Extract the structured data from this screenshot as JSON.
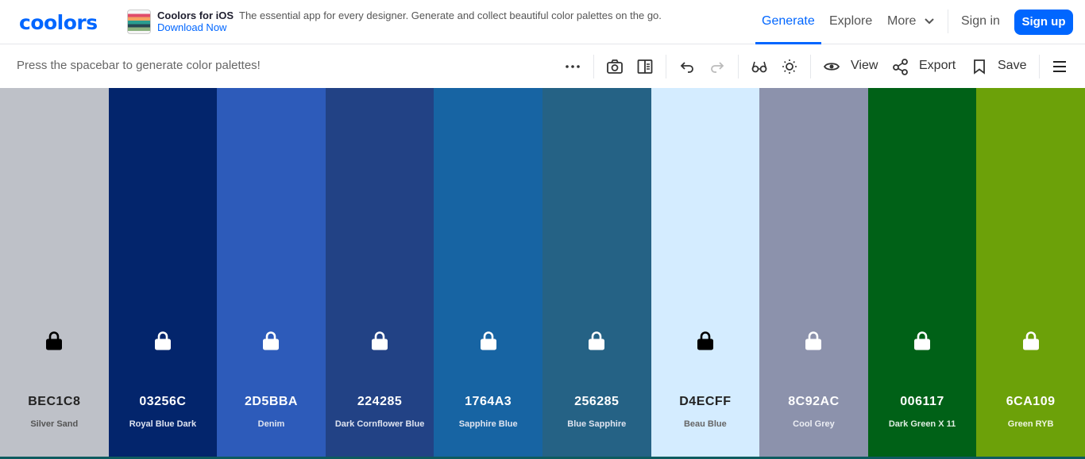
{
  "logo": "coolors",
  "promo": {
    "title": "Coolors for iOS",
    "description": "The essential app for every designer. Generate and collect beautiful color palettes on the go.",
    "link": "Download Now"
  },
  "nav": {
    "generate": "Generate",
    "explore": "Explore",
    "more": "More",
    "signin": "Sign in",
    "signup": "Sign up"
  },
  "toolbar": {
    "hint": "Press the spacebar to generate color palettes!",
    "view": "View",
    "export": "Export",
    "save": "Save"
  },
  "accent_color": "#0066ff",
  "swatches": [
    {
      "hex": "BEC1C8",
      "name": "Silver Sand",
      "color": "#BEC1C8",
      "text_color": "#222222",
      "name_color": "#555555",
      "lock_color": "#000000"
    },
    {
      "hex": "03256C",
      "name": "Royal Blue Dark",
      "color": "#03256C",
      "text_color": "#ffffff",
      "name_color": "#dfe4f0",
      "lock_color": "#ffffff"
    },
    {
      "hex": "2D5BBA",
      "name": "Denim",
      "color": "#2D5BBA",
      "text_color": "#ffffff",
      "name_color": "#dfe4f0",
      "lock_color": "#ffffff"
    },
    {
      "hex": "224285",
      "name": "Dark Cornflower Blue",
      "color": "#224285",
      "text_color": "#ffffff",
      "name_color": "#dfe4f0",
      "lock_color": "#ffffff"
    },
    {
      "hex": "1764A3",
      "name": "Sapphire Blue",
      "color": "#1764A3",
      "text_color": "#ffffff",
      "name_color": "#dfe4f0",
      "lock_color": "#ffffff"
    },
    {
      "hex": "256285",
      "name": "Blue Sapphire",
      "color": "#256285",
      "text_color": "#ffffff",
      "name_color": "#dfe4f0",
      "lock_color": "#ffffff"
    },
    {
      "hex": "D4ECFF",
      "name": "Beau Blue",
      "color": "#D4ECFF",
      "text_color": "#222222",
      "name_color": "#666666",
      "lock_color": "#000000"
    },
    {
      "hex": "8C92AC",
      "name": "Cool Grey",
      "color": "#8C92AC",
      "text_color": "#ffffff",
      "name_color": "#eceef4",
      "lock_color": "#ffffff"
    },
    {
      "hex": "006117",
      "name": "Dark Green X 11",
      "color": "#006117",
      "text_color": "#ffffff",
      "name_color": "#dfeee2",
      "lock_color": "#ffffff"
    },
    {
      "hex": "6CA109",
      "name": "Green RYB",
      "color": "#6CA109",
      "text_color": "#ffffff",
      "name_color": "#eef5e0",
      "lock_color": "#ffffff"
    }
  ]
}
